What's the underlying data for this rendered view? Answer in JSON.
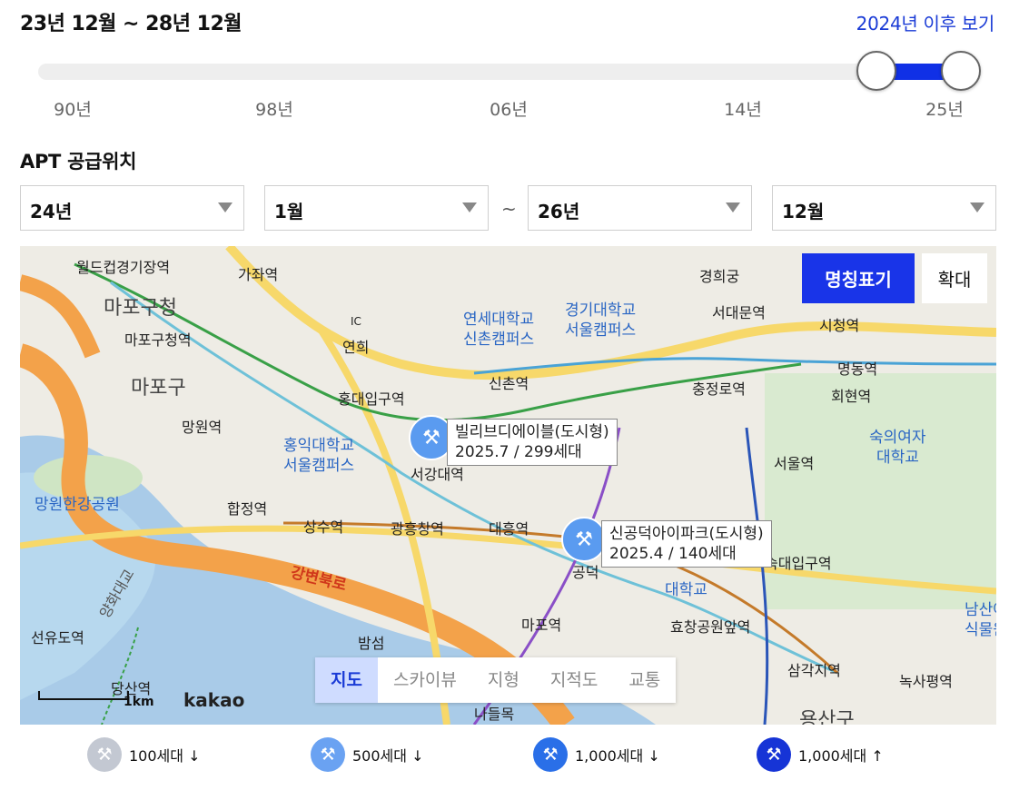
{
  "header": {
    "range": "23년 12월 ~ 28년 12월",
    "view_link": "2024년 이후 보기"
  },
  "slider": {
    "ticks": [
      "90년",
      "98년",
      "06년",
      "14년",
      "25년"
    ],
    "selection_start": "23년 12월",
    "selection_end": "28년 12월",
    "fill_color": "#1030e6"
  },
  "section": {
    "title": "APT 공급위치"
  },
  "filters": {
    "start_year": "24년",
    "start_month": "1월",
    "separator": "~",
    "end_year": "26년",
    "end_month": "12월"
  },
  "map": {
    "btn_names": "명칭표기",
    "btn_zoom": "확대",
    "map_types": [
      "지도",
      "스카이뷰",
      "지형",
      "지적도",
      "교통"
    ],
    "active_type": "지도",
    "scale": "1km",
    "brand": "kakao",
    "popups": [
      {
        "name": "빌리브디에이블(도시형)",
        "info": "2025.7 / 299세대"
      },
      {
        "name": "신공덕아이파크(도시형)",
        "info": "2025.4 / 140세대"
      }
    ],
    "labels": {
      "worldcup": "월드컵경기장역",
      "gajwa": "가좌역",
      "mapo_office": "마포구청",
      "mapo_office_st": "마포구청역",
      "ic": "IC",
      "yeonhui": "연희",
      "yonsei": "연세대학교",
      "yonsei2": "신촌캠퍼스",
      "kyonggi": "경기대학교",
      "kyonggi2": "서울캠퍼스",
      "gyeonghui": "경희궁",
      "seodaemun": "서대문역",
      "cityhall": "시청역",
      "mapogu": "마포구",
      "sinchon": "신촌역",
      "hongdae_st": "홍대입구역",
      "chungjeongno": "충정로역",
      "myeongdong": "명동역",
      "hoehyeon": "회현역",
      "mangwon": "망원역",
      "hongik": "홍익대학교",
      "hongik2": "서울캠퍼스",
      "sookmyung": "숙의여자",
      "sookmyung2": "대학교",
      "seoul_st": "서울역",
      "mangwon_park": "망원한강공원",
      "hapjeong": "합정역",
      "sangsu": "상수역",
      "gwangheung": "광흥창역",
      "daeheung": "대흥역",
      "gangbyeon": "강변북로",
      "mapo_st": "마포역",
      "hyochang": "효창공원앞역",
      "namsan": "남산야",
      "namsan2": "식물원",
      "seonyudo": "선유도역",
      "bamseom": "밤섬",
      "samgakji": "삼각지역",
      "noksapyeong": "녹사평역",
      "dangsan": "당산역",
      "yongsan": "용산구",
      "nadeulmok": "나들목",
      "yanghwa": "양화대교",
      "seogang": "서강대역",
      "gongdeok": "공덕",
      "sookdae": "숙대입구역",
      "daehakgyo": "대학교"
    }
  },
  "legend": [
    {
      "label": "100세대 ↓",
      "color": "#c3c8d2",
      "icon": "hammer-icon"
    },
    {
      "label": "500세대 ↓",
      "color": "#6aa2f2",
      "icon": "hammer-icon"
    },
    {
      "label": "1,000세대 ↓",
      "color": "#2a6fe8",
      "icon": "hammer-icon"
    },
    {
      "label": "1,000세대 ↑",
      "color": "#1634d6",
      "icon": "hammer-icon"
    }
  ]
}
